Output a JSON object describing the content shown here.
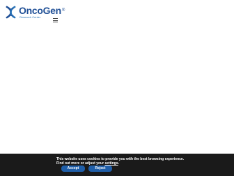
{
  "header": {
    "logo": {
      "name": "OncoGen",
      "reg": "®",
      "tagline": "Research Center",
      "icon": "double-helix-logo-icon"
    },
    "menu_icon": "hamburger-menu-icon"
  },
  "cookie_banner": {
    "line1": "This website uses cookies to provide you with the best browsing experience.",
    "line2_prefix": "Find out more or adjust your ",
    "settings_link": "settings",
    "line2_suffix": ".",
    "accept_label": "Accept",
    "reject_label": "Reject"
  },
  "colors": {
    "brand": "#1f4f96",
    "button": "#1f5ea8",
    "banner_bg": "#1a1a1a"
  }
}
